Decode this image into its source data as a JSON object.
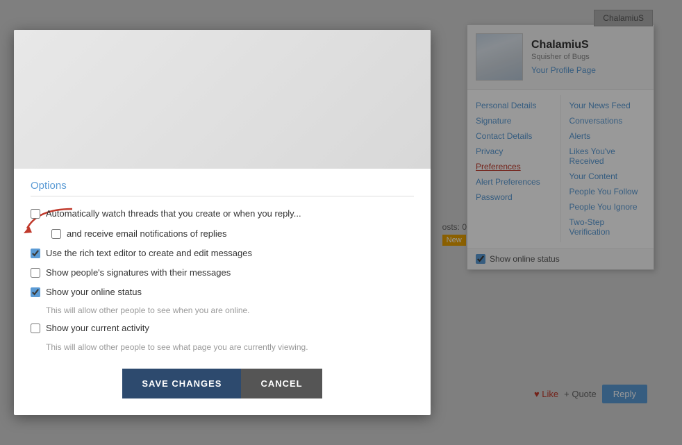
{
  "page": {
    "background_color": "#c8c8c8"
  },
  "tab_button": {
    "label": "ChalamiuS"
  },
  "dropdown": {
    "username": "ChalamiuS",
    "subtitle": "Squisher of Bugs",
    "profile_link": "Your Profile Page",
    "left_nav": [
      {
        "label": "Personal Details",
        "active": false
      },
      {
        "label": "Signature",
        "active": false
      },
      {
        "label": "Contact Details",
        "active": false
      },
      {
        "label": "Privacy",
        "active": false
      },
      {
        "label": "Preferences",
        "active": true
      },
      {
        "label": "Alert Preferences",
        "active": false
      },
      {
        "label": "Password",
        "active": false
      }
    ],
    "right_nav": [
      {
        "label": "Your News Feed",
        "active": false
      },
      {
        "label": "Conversations",
        "active": false
      },
      {
        "label": "Alerts",
        "active": false
      },
      {
        "label": "Likes You've Received",
        "active": false
      },
      {
        "label": "Your Content",
        "active": false
      },
      {
        "label": "People You Follow",
        "active": false
      },
      {
        "label": "People You Ignore",
        "active": false
      },
      {
        "label": "Two-Step Verification",
        "active": false
      }
    ],
    "footer": {
      "show_online_label": "Show online status",
      "show_online_checked": true
    }
  },
  "reply_area": {
    "like_label": "♥ Like",
    "quote_label": "+ Quote",
    "reply_label": "Reply"
  },
  "posts_label": "osts: 0",
  "new_badge": "New",
  "modal": {
    "section_title": "Options",
    "options": [
      {
        "id": "watch_threads",
        "label": "Automatically watch threads that you create or when you reply...",
        "checked": false,
        "description": null,
        "indented": false
      },
      {
        "id": "email_notifications",
        "label": "and receive email notifications of replies",
        "checked": false,
        "description": null,
        "indented": true
      },
      {
        "id": "rich_editor",
        "label": "Use the rich text editor to create and edit messages",
        "checked": true,
        "description": null,
        "indented": false
      },
      {
        "id": "show_signatures",
        "label": "Show people's signatures with their messages",
        "checked": false,
        "description": null,
        "indented": false
      },
      {
        "id": "show_online_status",
        "label": "Show your online status",
        "checked": true,
        "description": "This will allow other people to see when you are online.",
        "indented": false
      },
      {
        "id": "show_activity",
        "label": "Show your current activity",
        "checked": false,
        "description": "This will allow other people to see what page you are currently viewing.",
        "indented": false
      }
    ],
    "footer": {
      "save_label": "SAVE CHANGES",
      "cancel_label": "CANCEL"
    }
  }
}
